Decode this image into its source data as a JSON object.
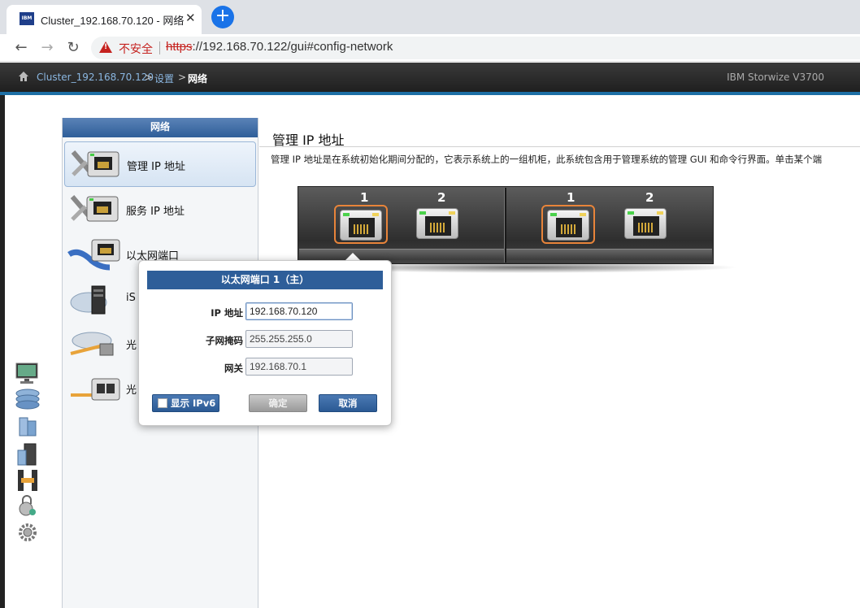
{
  "browser": {
    "tab_title": "Cluster_192.168.70.120 - 网络",
    "favicon_text": "IBM",
    "close_glyph": "✕",
    "newtab_glyph": "+",
    "back_glyph": "←",
    "forward_glyph": "→",
    "reload_glyph": "↻",
    "security_label": "不安全",
    "url_scheme": "https",
    "url_rest": "://192.168.70.122/gui#config-network"
  },
  "header": {
    "breadcrumb": [
      "Cluster_192.168.70.120",
      ">",
      "设置",
      ">",
      "网络"
    ],
    "product": "IBM Storwize V3700"
  },
  "sidebar": {
    "title": "网络",
    "items": [
      {
        "label": "管理 IP 地址",
        "icon": "management-ip-icon"
      },
      {
        "label": "服务 IP 地址",
        "icon": "service-ip-icon"
      },
      {
        "label": "以太网端口",
        "icon": "ethernet-port-icon"
      },
      {
        "label": "iS",
        "icon": "iscsi-icon"
      },
      {
        "label": "光",
        "icon": "fibre-channel-icon"
      },
      {
        "label": "光",
        "icon": "fibre-channel-ports-icon"
      }
    ]
  },
  "content": {
    "title": "管理 IP 地址",
    "description": "管理 IP 地址是在系统初始化期间分配的，它表示系统上的一组机柜，此系统包含用于管理系统的管理 GUI 和命令行界面。单击某个端"
  },
  "ports": {
    "left": [
      {
        "num": "1",
        "active": true
      },
      {
        "num": "2",
        "active": false
      }
    ],
    "right": [
      {
        "num": "1",
        "active": true
      },
      {
        "num": "2",
        "active": false
      }
    ]
  },
  "popup": {
    "title": "以太网端口 1（主）",
    "ip_label": "IP 地址",
    "ip_value": "192.168.70.120",
    "subnet_label": "子网掩码",
    "subnet_value": "255.255.255.0",
    "gateway_label": "网关",
    "gateway_value": "192.168.70.1",
    "ipv6_label": "显示 IPv6",
    "ok_label": "确定",
    "cancel_label": "取消"
  },
  "colors": {
    "accent_blue": "#2e5e99",
    "port_highlight": "#e8843a",
    "insecure_red": "#c5221f"
  }
}
